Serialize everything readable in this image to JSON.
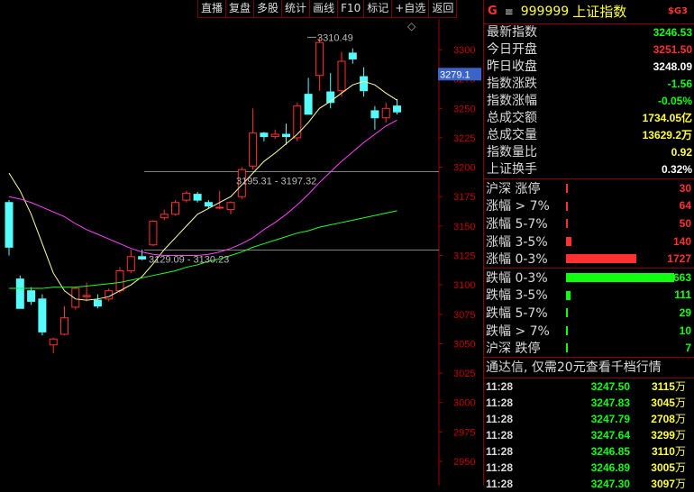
{
  "toolbar": {
    "buttons": [
      "直播",
      "复盘",
      "多股",
      "统计",
      "画线",
      "F10",
      "标记",
      "+自选",
      "返回"
    ]
  },
  "header": {
    "flag": "G",
    "menu_glyph": "≡",
    "code": "999999",
    "name": "上证指数",
    "badge": "$G3"
  },
  "quotes": [
    {
      "label": "最新指数",
      "value": "3246.53",
      "color": "#10ff10"
    },
    {
      "label": "今日开盘",
      "value": "3251.50",
      "color": "#ff3030"
    },
    {
      "label": "昨日收盘",
      "value": "3248.09",
      "color": "#ffffff"
    },
    {
      "label": "指数涨跌",
      "value": "-1.56",
      "color": "#10ff10"
    },
    {
      "label": "指数涨幅",
      "value": "-0.05%",
      "color": "#10ff10"
    },
    {
      "label": "总成交额",
      "value": "1734.05亿",
      "color": "#ffff3c"
    },
    {
      "label": "总成交量",
      "value": "13629.2万",
      "color": "#ffff3c"
    },
    {
      "label": "指数量比",
      "value": "0.92",
      "color": "#ffff3c"
    },
    {
      "label": "上证换手",
      "value": "0.32%",
      "color": "#ffffff"
    }
  ],
  "breadth_up": [
    {
      "label": "沪深 涨停",
      "value": "30",
      "ratio": 0.0
    },
    {
      "label": "涨幅 > 7%",
      "value": "64",
      "ratio": 0.0
    },
    {
      "label": "涨幅 5-7%",
      "value": "50",
      "ratio": 0.0
    },
    {
      "label": "涨幅 3-5%",
      "value": "140",
      "ratio": 0.053
    },
    {
      "label": "涨幅 0-3%",
      "value": "1727",
      "ratio": 0.649
    }
  ],
  "breadth_down": [
    {
      "label": "跌幅 0-3%",
      "value": "2663",
      "ratio": 1.0
    },
    {
      "label": "跌幅 3-5%",
      "value": "111",
      "ratio": 0.042
    },
    {
      "label": "跌幅 5-7%",
      "value": "29",
      "ratio": 0.0
    },
    {
      "label": "跌幅 > 7%",
      "value": "10",
      "ratio": 0.0
    },
    {
      "label": "沪深 跌停",
      "value": "7",
      "ratio": 0.0
    }
  ],
  "colors": {
    "up": "#ff3030",
    "down": "#10ff10",
    "bar_up": "#ff3030",
    "bar_down": "#10ff10"
  },
  "ad_text": "通达信, 仅需20元查看千档行情",
  "ticks": [
    {
      "time": "11:28",
      "price": "3247.50",
      "vol": "3115",
      "unit": "万"
    },
    {
      "time": "11:28",
      "price": "3247.83",
      "vol": "3045",
      "unit": "万"
    },
    {
      "time": "11:28",
      "price": "3247.79",
      "vol": "2708",
      "unit": "万"
    },
    {
      "time": "11:28",
      "price": "3247.64",
      "vol": "3299",
      "unit": "万"
    },
    {
      "time": "11:28",
      "price": "3246.85",
      "vol": "3110",
      "unit": "万"
    },
    {
      "time": "11:28",
      "price": "3246.89",
      "vol": "3005",
      "unit": "万"
    },
    {
      "time": "11:28",
      "price": "3247.30",
      "vol": "3097",
      "unit": "万"
    }
  ],
  "chart_data": {
    "type": "candlestick",
    "y_ticks": [
      3300,
      3275,
      3250,
      3225,
      3200,
      3175,
      3150,
      3125,
      3100,
      3075,
      3050,
      3025,
      3000,
      2975,
      2950
    ],
    "ylim": [
      2940,
      3330
    ],
    "current_price_label": "3279.1",
    "current_price": 3279.1,
    "candles": [
      {
        "o": 3170,
        "h": 3172,
        "l": 3125,
        "c": 3132
      },
      {
        "o": 3105,
        "h": 3108,
        "l": 3080,
        "c": 3080
      },
      {
        "o": 3095,
        "h": 3098,
        "l": 3083,
        "c": 3086
      },
      {
        "o": 3088,
        "h": 3092,
        "l": 3057,
        "c": 3060
      },
      {
        "o": 3049,
        "h": 3055,
        "l": 3042,
        "c": 3054
      },
      {
        "o": 3058,
        "h": 3082,
        "l": 3057,
        "c": 3072
      },
      {
        "o": 3081,
        "h": 3098,
        "l": 3079,
        "c": 3097
      },
      {
        "o": 3090,
        "h": 3102,
        "l": 3086,
        "c": 3091
      },
      {
        "o": 3087,
        "h": 3092,
        "l": 3080,
        "c": 3082
      },
      {
        "o": 3088,
        "h": 3097,
        "l": 3086,
        "c": 3095
      },
      {
        "o": 3095,
        "h": 3115,
        "l": 3093,
        "c": 3112
      },
      {
        "o": 3112,
        "h": 3130,
        "l": 3110,
        "c": 3124
      },
      {
        "o": 3124,
        "h": 3130,
        "l": 3121,
        "c": 3122
      },
      {
        "o": 3134,
        "h": 3155,
        "l": 3133,
        "c": 3154
      },
      {
        "o": 3157,
        "h": 3164,
        "l": 3155,
        "c": 3160
      },
      {
        "o": 3160,
        "h": 3172,
        "l": 3159,
        "c": 3170
      },
      {
        "o": 3172,
        "h": 3180,
        "l": 3170,
        "c": 3178
      },
      {
        "o": 3177,
        "h": 3179,
        "l": 3170,
        "c": 3172
      },
      {
        "o": 3170,
        "h": 3172,
        "l": 3165,
        "c": 3167
      },
      {
        "o": 3166,
        "h": 3180,
        "l": 3164,
        "c": 3166
      },
      {
        "o": 3164,
        "h": 3171,
        "l": 3160,
        "c": 3170
      },
      {
        "o": 3175,
        "h": 3200,
        "l": 3173,
        "c": 3198
      },
      {
        "o": 3201,
        "h": 3250,
        "l": 3198,
        "c": 3229
      },
      {
        "o": 3229,
        "h": 3230,
        "l": 3222,
        "c": 3226
      },
      {
        "o": 3226,
        "h": 3232,
        "l": 3224,
        "c": 3228
      },
      {
        "o": 3228,
        "h": 3237,
        "l": 3219,
        "c": 3226
      },
      {
        "o": 3225,
        "h": 3255,
        "l": 3222,
        "c": 3252
      },
      {
        "o": 3262,
        "h": 3276,
        "l": 3255,
        "c": 3245
      },
      {
        "o": 3278,
        "h": 3310,
        "l": 3265,
        "c": 3306
      },
      {
        "o": 3264,
        "h": 3280,
        "l": 3250,
        "c": 3255
      },
      {
        "o": 3265,
        "h": 3298,
        "l": 3260,
        "c": 3290
      },
      {
        "o": 3297,
        "h": 3301,
        "l": 3288,
        "c": 3292
      },
      {
        "o": 3277,
        "h": 3285,
        "l": 3260,
        "c": 3265
      },
      {
        "o": 3248,
        "h": 3252,
        "l": 3232,
        "c": 3242
      },
      {
        "o": 3242,
        "h": 3255,
        "l": 3238,
        "c": 3250
      },
      {
        "o": 3252,
        "h": 3258,
        "l": 3245,
        "c": 3247
      }
    ],
    "ma_series": [
      {
        "color": "#ffffa0",
        "values": [
          3195,
          3180,
          3160,
          3135,
          3110,
          3095,
          3088,
          3087,
          3088,
          3090,
          3095,
          3100,
          3107,
          3118,
          3130,
          3140,
          3150,
          3160,
          3165,
          3170,
          3175,
          3185,
          3195,
          3205,
          3212,
          3220,
          3228,
          3238,
          3250,
          3256,
          3263,
          3270,
          3273,
          3270,
          3263,
          3257
        ]
      },
      {
        "color": "#ff40ff",
        "values": [
          3175,
          3173,
          3170,
          3166,
          3162,
          3158,
          3152,
          3147,
          3143,
          3139,
          3135,
          3131,
          3128,
          3126,
          3125,
          3125,
          3125,
          3125,
          3126,
          3128,
          3131,
          3135,
          3140,
          3147,
          3153,
          3160,
          3168,
          3177,
          3187,
          3196,
          3205,
          3213,
          3221,
          3228,
          3235,
          3240
        ]
      },
      {
        "color": "#20ff20",
        "values": [
          3097,
          3097,
          3097,
          3097,
          3098,
          3098,
          3098,
          3099,
          3100,
          3101,
          3102,
          3104,
          3106,
          3108,
          3110,
          3112,
          3115,
          3117,
          3120,
          3122,
          3125,
          3128,
          3132,
          3135,
          3138,
          3141,
          3144,
          3146,
          3149,
          3151,
          3153,
          3155,
          3157,
          3159,
          3161,
          3163
        ]
      }
    ],
    "annotations": [
      {
        "text": "3310.49",
        "value": 3310.49
      },
      {
        "text": "3195.31 - 3197.32",
        "value": 3196.3
      },
      {
        "text": "3129.09 - 3130.23",
        "value": 3129.7
      }
    ],
    "diamond_glyph": "◇"
  }
}
